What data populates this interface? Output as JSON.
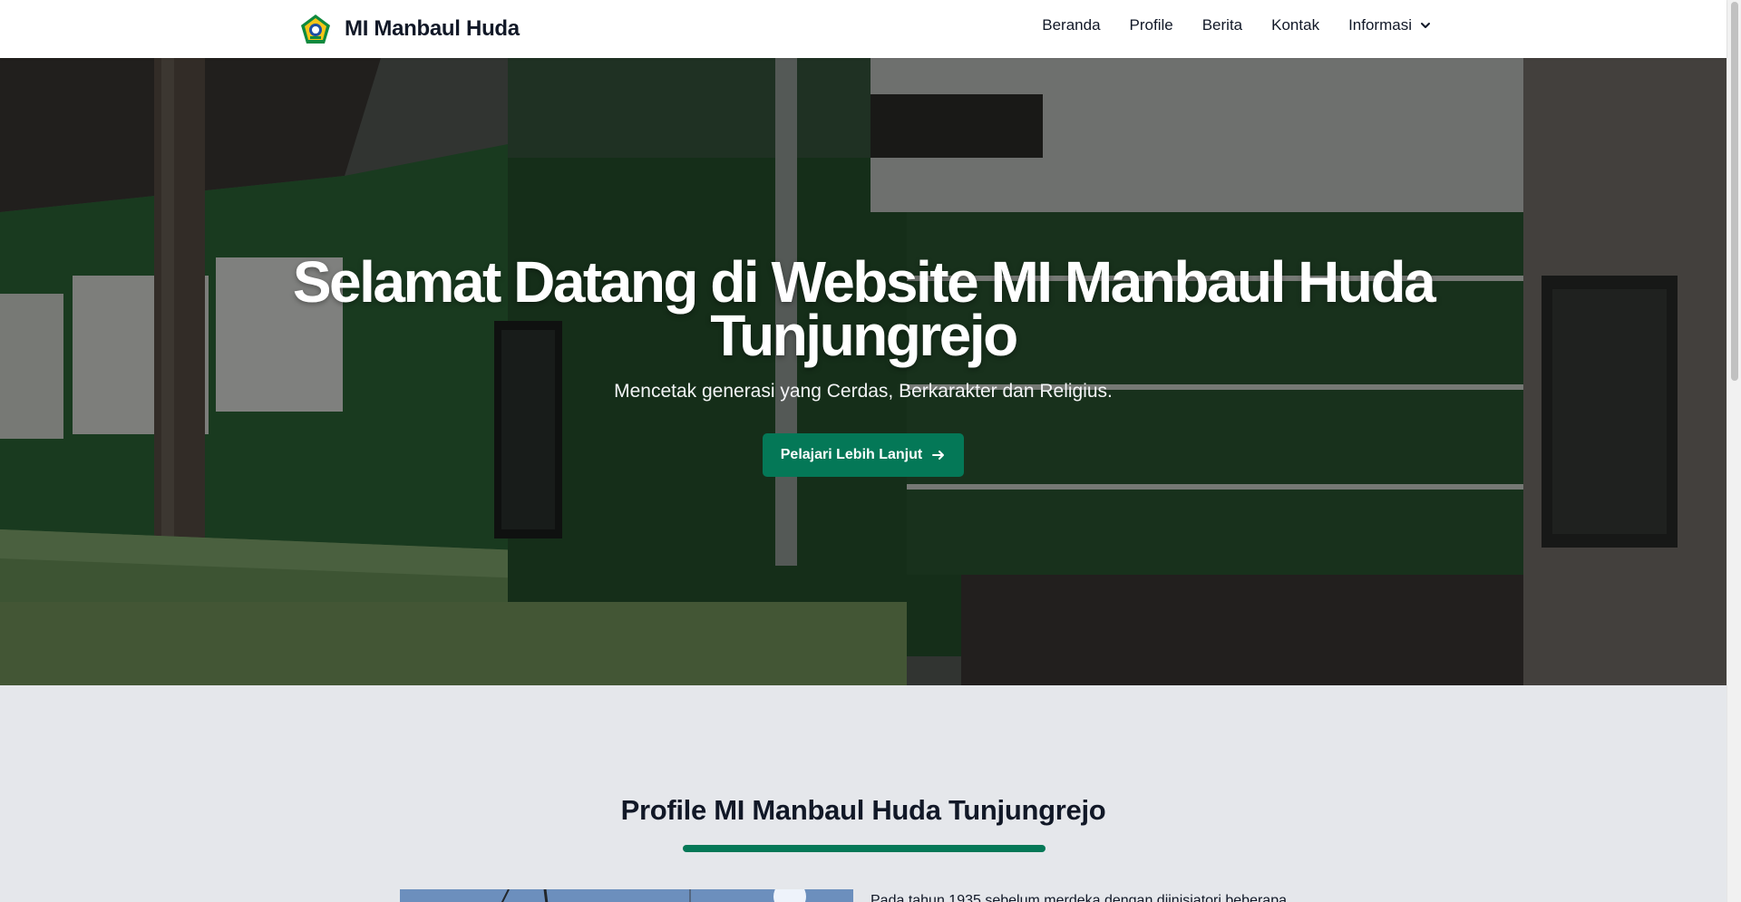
{
  "colors": {
    "accent": "#047857",
    "navbar_bg": "#ffffff",
    "section_bg": "#e5e7eb",
    "text": "#111827"
  },
  "navbar": {
    "brand_name": "MI Manbaul Huda",
    "logo_icon": "school-emblem-icon",
    "items": [
      {
        "label": "Beranda"
      },
      {
        "label": "Profile"
      },
      {
        "label": "Berita"
      },
      {
        "label": "Kontak"
      },
      {
        "label": "Informasi",
        "icon": "chevron-down-icon"
      }
    ]
  },
  "hero": {
    "title": "Selamat Datang di Website MI Manbaul Huda Tunjungrejo",
    "subtitle": "Mencetak generasi yang Cerdas, Berkarakter dan Religius.",
    "cta_label": "Pelajari Lebih Lanjut",
    "cta_icon": "arrow-right-icon",
    "background": "school-building-photo"
  },
  "profile": {
    "title": "Profile MI Manbaul Huda Tunjungrejo",
    "paragraph": "Pada tahun 1935 sebelum merdeka dengan diinisiatori beberapa"
  }
}
